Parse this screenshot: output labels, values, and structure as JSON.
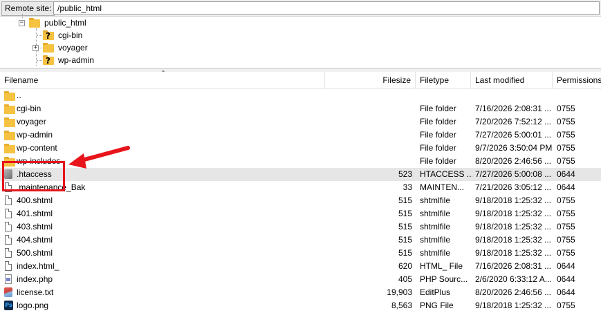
{
  "remote": {
    "label": "Remote site:",
    "path": "/public_html"
  },
  "tree": {
    "root": "public_html",
    "children": [
      "cgi-bin",
      "voyager",
      "wp-admin"
    ]
  },
  "columns": {
    "filename": "Filename",
    "filesize": "Filesize",
    "filetype": "Filetype",
    "modified": "Last modified",
    "permissions": "Permissions"
  },
  "files": [
    {
      "name": "..",
      "size": "",
      "type": "",
      "modified": "",
      "perm": "",
      "icon": "folder-icon"
    },
    {
      "name": "cgi-bin",
      "size": "",
      "type": "File folder",
      "modified": "7/16/2026 2:08:31 ...",
      "perm": "0755",
      "icon": "folder-icon"
    },
    {
      "name": "voyager",
      "size": "",
      "type": "File folder",
      "modified": "7/20/2026 7:52:12 ...",
      "perm": "0755",
      "icon": "folder-icon"
    },
    {
      "name": "wp-admin",
      "size": "",
      "type": "File folder",
      "modified": "7/27/2026 5:00:01 ...",
      "perm": "0755",
      "icon": "folder-icon"
    },
    {
      "name": "wp-content",
      "size": "",
      "type": "File folder",
      "modified": "9/7/2026 3:50:04 PM",
      "perm": "0755",
      "icon": "folder-icon"
    },
    {
      "name": "wp-includes",
      "size": "",
      "type": "File folder",
      "modified": "8/20/2026 2:46:56 ...",
      "perm": "0755",
      "icon": "folder-icon"
    },
    {
      "name": ".htaccess",
      "size": "523",
      "type": "HTACCESS ...",
      "modified": "7/27/2026 5:00:08 ...",
      "perm": "0644",
      "icon": "gear-file-icon"
    },
    {
      "name": ".maintenance_Bak",
      "size": "33",
      "type": "MAINTEN...",
      "modified": "7/21/2026 3:05:12 ...",
      "perm": "0644",
      "icon": "file-icon"
    },
    {
      "name": "400.shtml",
      "size": "515",
      "type": "shtmlfile",
      "modified": "9/18/2018 1:25:32 ...",
      "perm": "0755",
      "icon": "file-icon"
    },
    {
      "name": "401.shtml",
      "size": "515",
      "type": "shtmlfile",
      "modified": "9/18/2018 1:25:32 ...",
      "perm": "0755",
      "icon": "file-icon"
    },
    {
      "name": "403.shtml",
      "size": "515",
      "type": "shtmlfile",
      "modified": "9/18/2018 1:25:32 ...",
      "perm": "0755",
      "icon": "file-icon"
    },
    {
      "name": "404.shtml",
      "size": "515",
      "type": "shtmlfile",
      "modified": "9/18/2018 1:25:32 ...",
      "perm": "0755",
      "icon": "file-icon"
    },
    {
      "name": "500.shtml",
      "size": "515",
      "type": "shtmlfile",
      "modified": "9/18/2018 1:25:32 ...",
      "perm": "0755",
      "icon": "file-icon"
    },
    {
      "name": "index.html_",
      "size": "620",
      "type": "HTML_ File",
      "modified": "7/16/2026 2:08:31 ...",
      "perm": "0644",
      "icon": "file-icon"
    },
    {
      "name": "index.php",
      "size": "405",
      "type": "PHP Sourc...",
      "modified": "2/6/2020 6:33:12 A...",
      "perm": "0644",
      "icon": "php-file-icon"
    },
    {
      "name": "license.txt",
      "size": "19,903",
      "type": "EditPlus",
      "modified": "8/20/2026 2:46:56 ...",
      "perm": "0644",
      "icon": "editplus-file-icon"
    },
    {
      "name": "logo.png",
      "size": "8,563",
      "type": "PNG File",
      "modified": "9/18/2018 1:25:32 ...",
      "perm": "0755",
      "icon": "photoshop-file-icon"
    }
  ],
  "selected_index": 6,
  "colors": {
    "highlight": "#e8141b",
    "selection": "#e6e6e6",
    "folder": "#f5c242"
  }
}
